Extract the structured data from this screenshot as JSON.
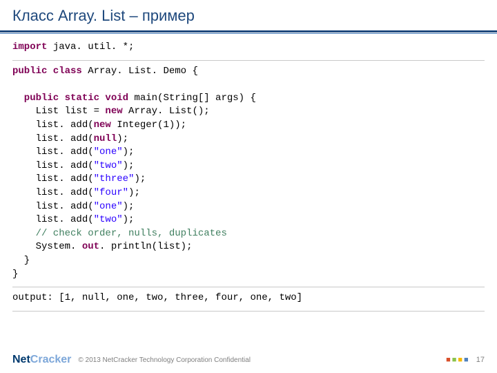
{
  "title": "Класс Array. List – пример",
  "code": {
    "l1a": "import",
    "l1b": " java. util. *;",
    "l2a": "public class",
    "l2b": " Array. List. Demo {",
    "l3a": "  public static void",
    "l3b": " main(String[] args) {",
    "l4a": "    List list = ",
    "l4b": "new",
    "l4c": " Array. List();",
    "l5a": "    list. add(",
    "l5b": "new",
    "l5c": " Integer(1));",
    "l6a": "    list. add(",
    "l6b": "null",
    "l6c": ");",
    "l7a": "    list. add(",
    "l7s": "\"one\"",
    "l7b": ");",
    "l8a": "    list. add(",
    "l8s": "\"two\"",
    "l8b": ");",
    "l9a": "    list. add(",
    "l9s": "\"three\"",
    "l9b": ");",
    "l10a": "    list. add(",
    "l10s": "\"four\"",
    "l10b": ");",
    "l11a": "    list. add(",
    "l11s": "\"one\"",
    "l11b": ");",
    "l12a": "    list. add(",
    "l12s": "\"two\"",
    "l12b": ");",
    "l13": "    // check order, nulls, duplicates",
    "l14a": "    System. ",
    "l14b": "out",
    "l14c": ". println(list);",
    "l15": "  }",
    "l16": "}"
  },
  "output_label": "output: ",
  "output_value": "[1, null, one, two, three, four, one, two]",
  "footer": {
    "logo_net": "Net",
    "logo_cracker": "Cracker",
    "copyright": "© 2013 NetCracker Technology Corporation Confidential",
    "page": "17"
  }
}
